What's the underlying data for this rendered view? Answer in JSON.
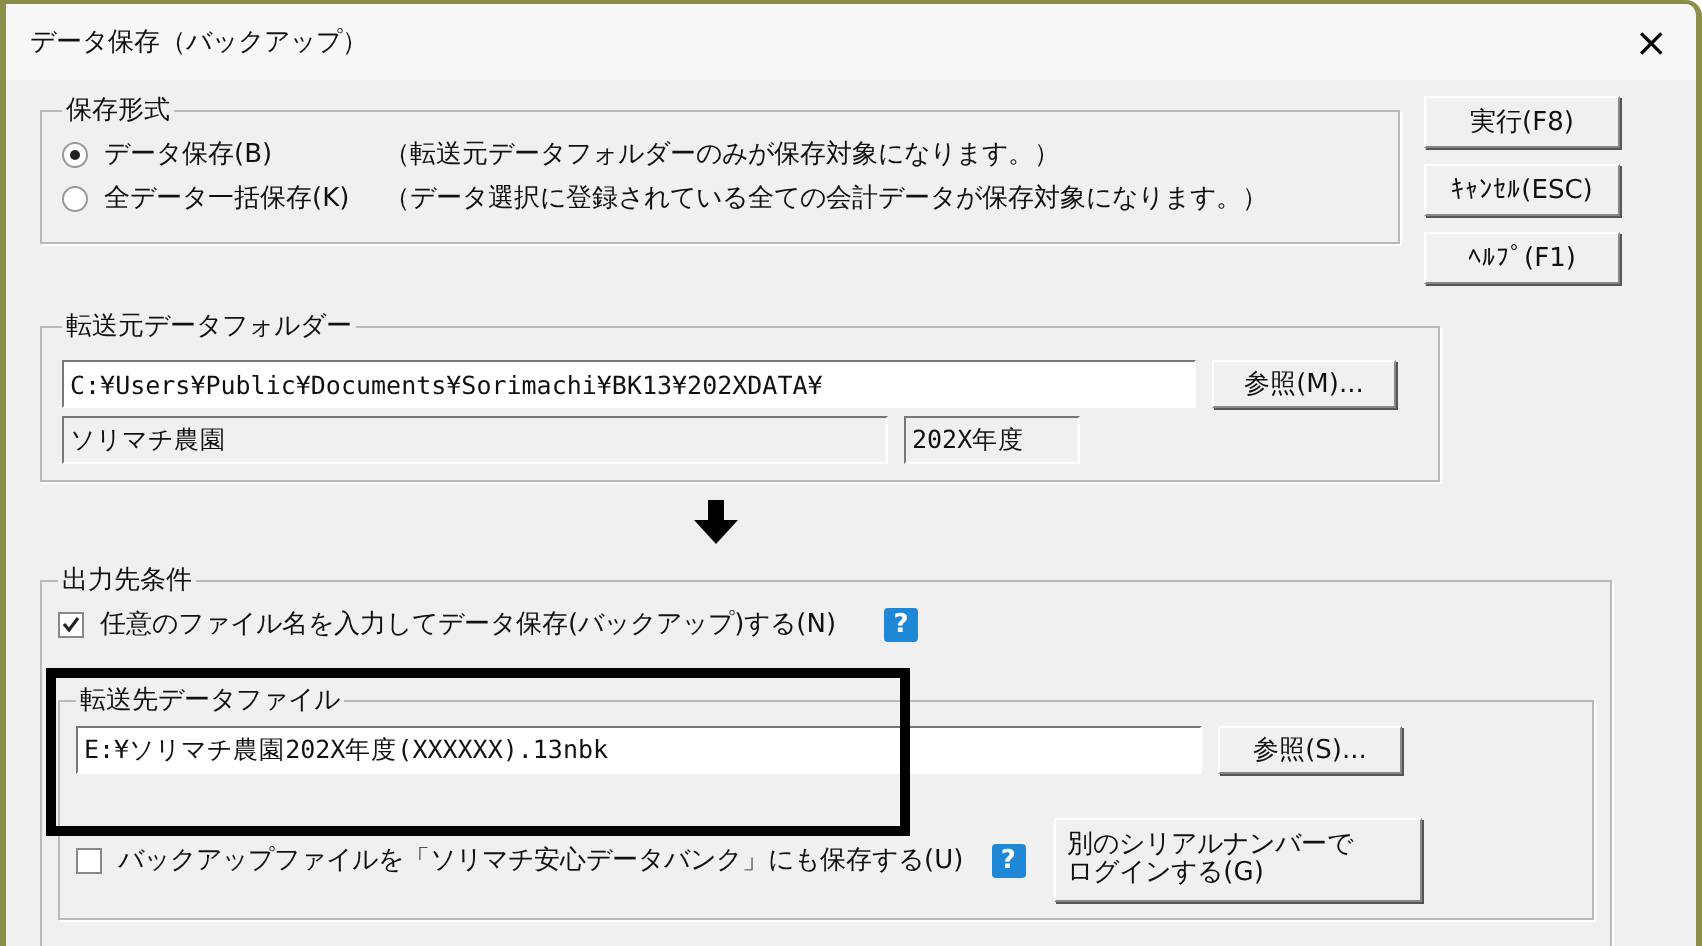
{
  "window": {
    "title": "データ保存（バックアップ）",
    "close": "×"
  },
  "save_format": {
    "label": "保存形式",
    "options": [
      {
        "label": "データ保存(B)",
        "note": "（転送元データフォルダーのみが保存対象になります。）",
        "selected": true
      },
      {
        "label": "全データ一括保存(K)",
        "note": "（データ選択に登録されている全ての会計データが保存対象になります。）",
        "selected": false
      }
    ]
  },
  "buttons": [
    "実行(F8)",
    "ｷｬﾝｾﾙ(ESC)",
    "ﾍﾙﾌﾟ(F1)"
  ],
  "source": {
    "label": "転送元データフォルダー",
    "path": "C:¥Users¥Public¥Documents¥Sorimachi¥BK13¥202XDATA¥",
    "browse": "参照(M)...",
    "company": "ソリマチ農園",
    "year": "202X年度"
  },
  "output": {
    "label": "出力先条件",
    "custom_name": {
      "label": "任意のファイル名を入力してデータ保存(バックアップ)する(N)",
      "checked": true,
      "help": "?"
    },
    "file": {
      "label": "転送先データファイル",
      "value": "E:¥ソリマチ農園202X年度(XXXXXX).13nbk",
      "browse": "参照(S)..."
    },
    "bank": {
      "label": "バックアップファイルを「ソリマチ安心データバンク」にも保存する(U)",
      "checked": false,
      "help": "?"
    },
    "login": [
      "別のシリアルナンバーで",
      "ログインする(G)"
    ]
  }
}
